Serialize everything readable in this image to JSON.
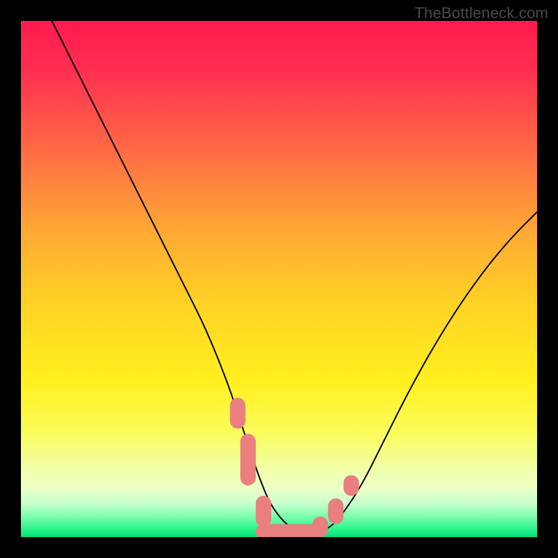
{
  "watermark": {
    "text": "TheBottleneck.com"
  },
  "chart_data": {
    "type": "line",
    "title": "",
    "xlabel": "",
    "ylabel": "",
    "xlim": [
      0,
      100
    ],
    "ylim": [
      0,
      100
    ],
    "grid": false,
    "legend": "none",
    "background_gradient_stops": [
      {
        "pos": 0.0,
        "color": "#ff1a4e"
      },
      {
        "pos": 0.1,
        "color": "#ff3050"
      },
      {
        "pos": 0.25,
        "color": "#ff6a44"
      },
      {
        "pos": 0.4,
        "color": "#ffa636"
      },
      {
        "pos": 0.55,
        "color": "#ffd324"
      },
      {
        "pos": 0.7,
        "color": "#fff020"
      },
      {
        "pos": 0.8,
        "color": "#fbfd5e"
      },
      {
        "pos": 0.86,
        "color": "#f2ffa0"
      },
      {
        "pos": 0.905,
        "color": "#ecffc7"
      },
      {
        "pos": 0.935,
        "color": "#c7ffcd"
      },
      {
        "pos": 0.96,
        "color": "#7dffad"
      },
      {
        "pos": 0.985,
        "color": "#28f48e"
      },
      {
        "pos": 1.0,
        "color": "#07e07a"
      }
    ],
    "series": [
      {
        "name": "bottleneck-curve",
        "color": "#000000",
        "stroke_width": 2,
        "x": [
          6,
          8,
          12,
          16,
          20,
          24,
          28,
          32,
          36,
          40,
          42,
          44,
          46,
          48,
          50,
          52,
          54,
          56,
          58,
          60,
          62,
          66,
          70,
          75,
          80,
          85,
          90,
          95,
          100
        ],
        "y": [
          100,
          96,
          88,
          80,
          72,
          64,
          56,
          48,
          40,
          30,
          24,
          18,
          12,
          7,
          4,
          2,
          1,
          1,
          1,
          2,
          4,
          10,
          18,
          28,
          37,
          45,
          52,
          58,
          63
        ]
      }
    ],
    "markers": {
      "name": "highlighted-points",
      "shape": "rounded-rect",
      "color": "#e97f7f",
      "approx_points": [
        {
          "x": 42,
          "y": 24,
          "w": 3,
          "h": 6
        },
        {
          "x": 44,
          "y": 15,
          "w": 3,
          "h": 10
        },
        {
          "x": 47,
          "y": 5,
          "w": 3,
          "h": 6
        },
        {
          "x": 52,
          "y": 1,
          "w": 13,
          "h": 3
        },
        {
          "x": 58,
          "y": 2,
          "w": 3,
          "h": 4
        },
        {
          "x": 61,
          "y": 5,
          "w": 3,
          "h": 5
        },
        {
          "x": 64,
          "y": 10,
          "w": 3,
          "h": 4
        }
      ]
    }
  }
}
